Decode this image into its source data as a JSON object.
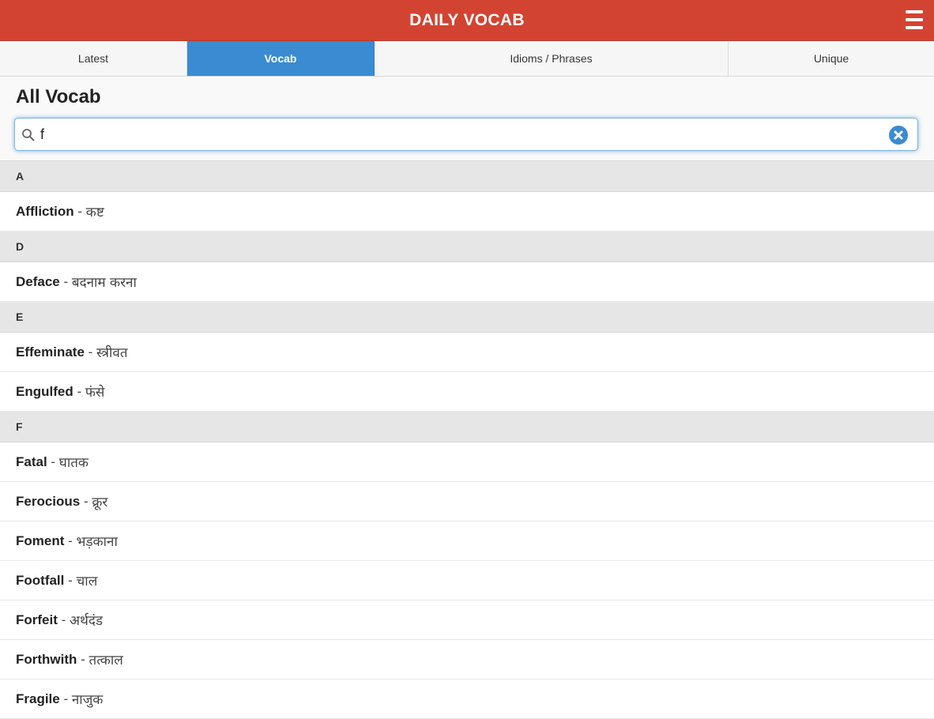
{
  "header": {
    "title": "DAILY VOCAB",
    "menu_icon": "hamburger-menu-icon"
  },
  "tabs": [
    {
      "label": "Latest",
      "active": false
    },
    {
      "label": "Vocab",
      "active": true
    },
    {
      "label": "Idioms / Phrases",
      "active": false
    },
    {
      "label": "Unique",
      "active": false
    }
  ],
  "page": {
    "title": "All Vocab"
  },
  "search": {
    "value": "f",
    "search_icon": "search-icon",
    "clear_icon": "clear-icon"
  },
  "colors": {
    "header_bg": "#d34332",
    "active_tab": "#3a8bd2"
  },
  "list": [
    {
      "type": "divider",
      "text": "A"
    },
    {
      "type": "item",
      "word": "Affliction",
      "sep": " - ",
      "meaning": "कष्ट"
    },
    {
      "type": "divider",
      "text": "D"
    },
    {
      "type": "item",
      "word": "Deface",
      "sep": " - ",
      "meaning": "बदनाम करना"
    },
    {
      "type": "divider",
      "text": "E"
    },
    {
      "type": "item",
      "word": "Effeminate",
      "sep": " - ",
      "meaning": "स्त्रीवत"
    },
    {
      "type": "item",
      "word": "Engulfed",
      "sep": " - ",
      "meaning": "फंसे"
    },
    {
      "type": "divider",
      "text": "F"
    },
    {
      "type": "item",
      "word": "Fatal",
      "sep": " - ",
      "meaning": "घातक"
    },
    {
      "type": "item",
      "word": "Ferocious",
      "sep": " - ",
      "meaning": "क्रूर"
    },
    {
      "type": "item",
      "word": "Foment",
      "sep": " - ",
      "meaning": "भड़काना"
    },
    {
      "type": "item",
      "word": "Footfall",
      "sep": " - ",
      "meaning": "चाल"
    },
    {
      "type": "item",
      "word": "Forfeit",
      "sep": " - ",
      "meaning": "अर्थदंड"
    },
    {
      "type": "item",
      "word": "Forthwith",
      "sep": " - ",
      "meaning": "तत्काल"
    },
    {
      "type": "item",
      "word": "Fragile",
      "sep": " - ",
      "meaning": "नाजुक"
    }
  ]
}
